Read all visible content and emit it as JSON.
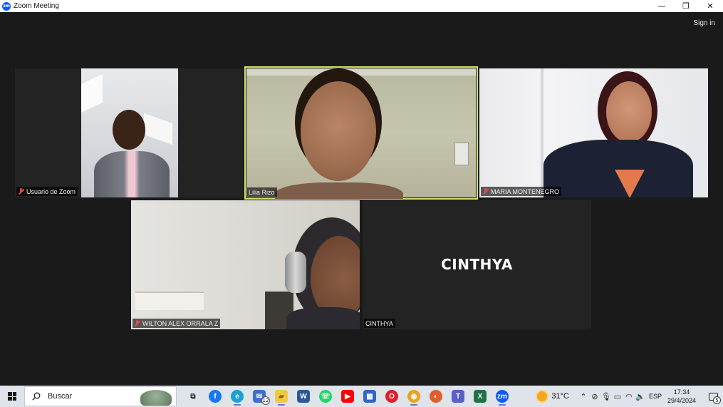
{
  "window": {
    "title": "Zoom Meeting",
    "logo_text": "zm",
    "minimize_label": "—",
    "restore_label": "❐",
    "close_label": "✕"
  },
  "header": {
    "signin_label": "Sign in"
  },
  "tiles": [
    {
      "name": "Usuario de Zoom",
      "muted": true,
      "video": true
    },
    {
      "name": "Lilia Rizo",
      "muted": false,
      "video": true,
      "active_speaker": true
    },
    {
      "name": "MARIA MONTENEGRO",
      "muted": true,
      "video": true
    },
    {
      "name": "WILTON ALEX ORRALA Z",
      "muted": true,
      "video": true
    },
    {
      "name": "CINTHYA",
      "muted": false,
      "video": false,
      "display_name": "CINTHYA"
    }
  ],
  "taskbar": {
    "search_placeholder": "Buscar",
    "mail_badge": "12",
    "apps": [
      {
        "icon": "task-view-icon",
        "glyph": "⧉",
        "color": "#dfe3ea",
        "text_color": "#222"
      },
      {
        "icon": "facebook-icon",
        "glyph": "f",
        "color": "#1877f2",
        "text_color": "#fff"
      },
      {
        "icon": "edge-icon",
        "glyph": "e",
        "color": "#1aa0d8",
        "text_color": "#fff"
      },
      {
        "icon": "mail-icon",
        "glyph": "✉",
        "color": "#3b6fd1",
        "text_color": "#fff"
      },
      {
        "icon": "file-explorer-icon",
        "glyph": "▰",
        "color": "#f2c744",
        "text_color": "#8a6a10"
      },
      {
        "icon": "word-icon",
        "glyph": "W",
        "color": "#2b5797",
        "text_color": "#fff"
      },
      {
        "icon": "whatsapp-icon",
        "glyph": "☏",
        "color": "#25d366",
        "text_color": "#fff"
      },
      {
        "icon": "youtube-icon",
        "glyph": "▶",
        "color": "#ff0000",
        "text_color": "#fff"
      },
      {
        "icon": "calendar-icon",
        "glyph": "▦",
        "color": "#3464c8",
        "text_color": "#fff"
      },
      {
        "icon": "opera-icon",
        "glyph": "O",
        "color": "#e01e2e",
        "text_color": "#fff"
      },
      {
        "icon": "chrome-icon",
        "glyph": "◉",
        "color": "#e8a321",
        "text_color": "#fff"
      },
      {
        "icon": "firefox-icon",
        "glyph": "◐",
        "color": "#e35d2a",
        "text_color": "#fff"
      },
      {
        "icon": "teams-icon",
        "glyph": "T",
        "color": "#5b5fc7",
        "text_color": "#fff"
      },
      {
        "icon": "excel-icon",
        "glyph": "X",
        "color": "#1f7244",
        "text_color": "#fff"
      },
      {
        "icon": "zoom-icon",
        "glyph": "zm",
        "color": "#0b5cff",
        "text_color": "#fff"
      }
    ],
    "weather": {
      "temperature": "31°C"
    },
    "language": "ESP",
    "time": "17:34",
    "date": "29/4/2024",
    "notification_count": "5"
  }
}
